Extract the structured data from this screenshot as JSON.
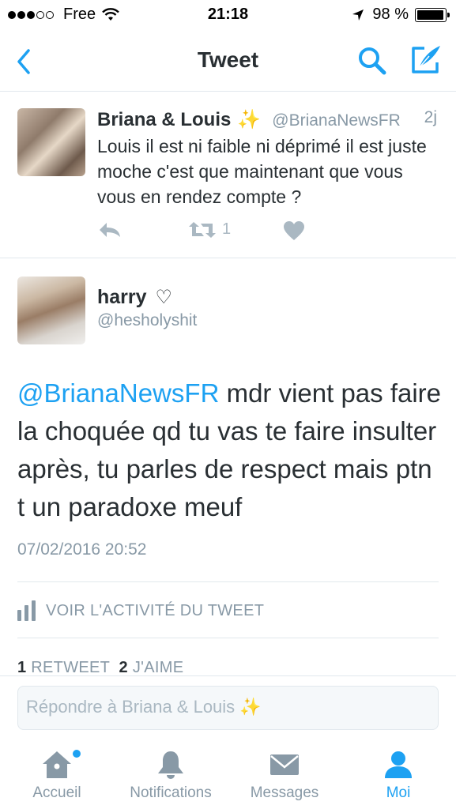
{
  "status_bar": {
    "carrier": "Free",
    "time": "21:18",
    "battery": "98 %",
    "battery_level": 0.98
  },
  "nav": {
    "title": "Tweet"
  },
  "parent_tweet": {
    "name": "Briana & Louis",
    "name_emoji": "✨",
    "handle": "@BrianaNewsFR",
    "time": "2j",
    "text": "Louis il est ni faible ni déprimé il est juste moche c'est que maintenant que vous vous en rendez compte ?",
    "retweet_count": "1"
  },
  "main_tweet": {
    "name": "harry",
    "name_heart": "♡",
    "handle": "@hesholyshit",
    "mention": "@BrianaNewsFR",
    "text": " mdr vient pas faire la choquée qd tu vas te faire insulter après, tu parles de respect mais ptn t un paradoxe meuf",
    "date": "07/02/2016 20:52",
    "activity_label": "VOIR L'ACTIVITÉ DU TWEET",
    "retweets_count": "1",
    "retweets_label": "RETWEET",
    "likes_count": "2",
    "likes_label": "J'AIME"
  },
  "reply": {
    "placeholder": "Répondre à Briana & Louis ✨"
  },
  "tabs": [
    {
      "label": "Accueil",
      "icon": "home-icon"
    },
    {
      "label": "Notifications",
      "icon": "bell-icon"
    },
    {
      "label": "Messages",
      "icon": "envelope-icon"
    },
    {
      "label": "Moi",
      "icon": "person-icon"
    }
  ],
  "colors": {
    "accent": "#1da1f2",
    "muted": "#8899a6",
    "text": "#292f33"
  }
}
